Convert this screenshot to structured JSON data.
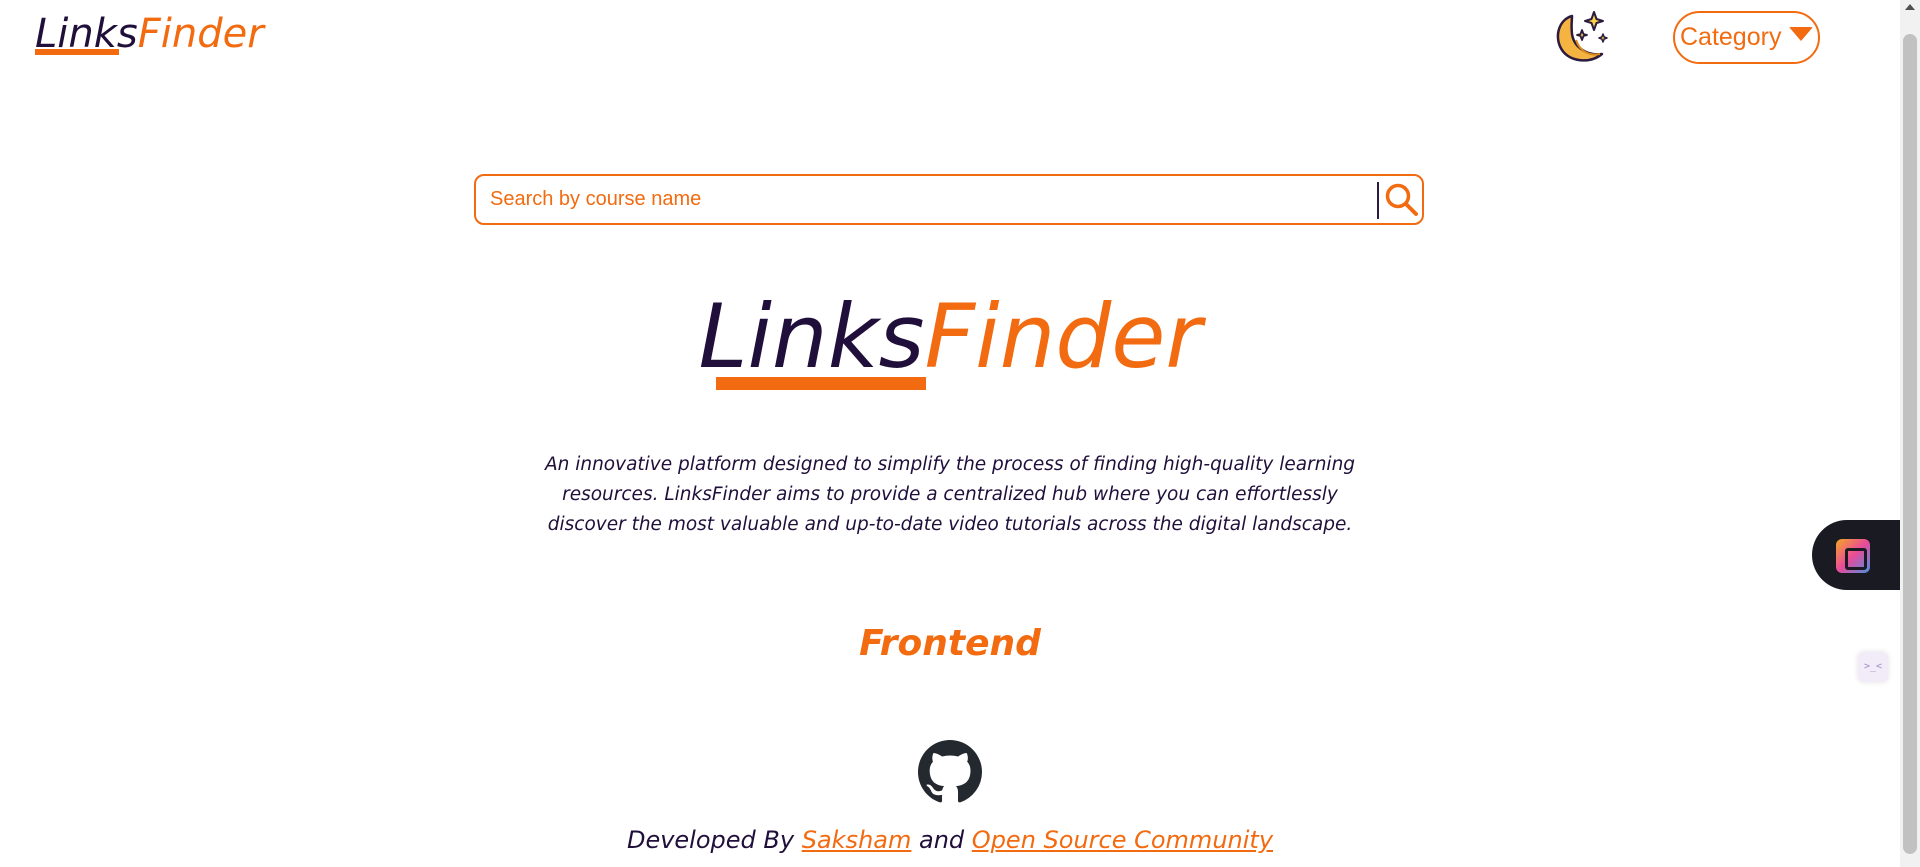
{
  "header": {
    "brand_part1": "Links",
    "brand_part2": "Finder",
    "category_label": "Category"
  },
  "search": {
    "placeholder": "Search by course name"
  },
  "hero": {
    "title_part1": "Links",
    "title_part2": "Finder",
    "description": "An innovative platform designed to simplify the process of finding high-quality learning resources. LinksFinder aims to provide a centralized hub where you can effortlessly discover the most valuable and up-to-date video tutorials across the digital landscape."
  },
  "section": {
    "title": "Frontend"
  },
  "footer": {
    "prefix": "Developed By",
    "author_link": "Saksham",
    "conjunction": "and",
    "community_link": "Open Source Community"
  },
  "widgets": {
    "mini_label": ">_<"
  },
  "colors": {
    "accent": "#f26b10",
    "dark": "#1f0f3a"
  }
}
